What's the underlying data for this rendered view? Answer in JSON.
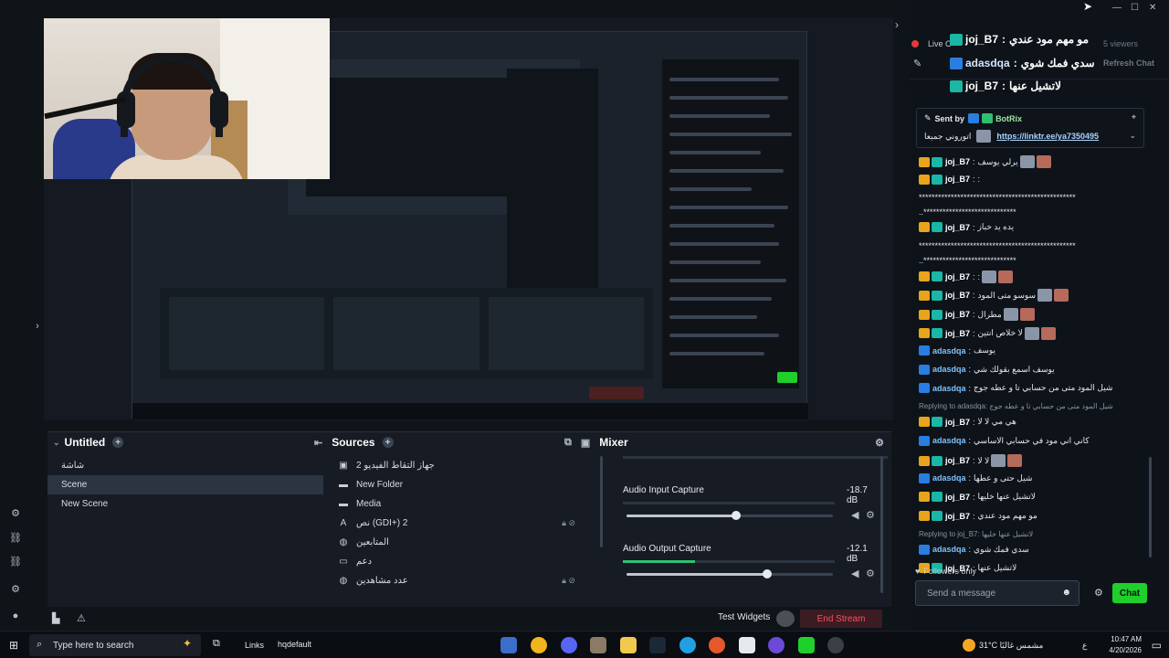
{
  "preview": {
    "nested_label": "Live Chat"
  },
  "docks": {
    "scenes": {
      "title": "Untitled",
      "items": [
        "شاشة",
        "Scene",
        "New Scene"
      ]
    },
    "sources": {
      "title": "Sources",
      "items": [
        {
          "icon": "camera-icon",
          "label": "جهاز التقاط الفيديو 2"
        },
        {
          "icon": "folder-icon",
          "label": "New Folder"
        },
        {
          "icon": "folder-icon",
          "label": "Media"
        },
        {
          "icon": "text-icon",
          "label": "نص (GDI+) 2"
        },
        {
          "icon": "globe-icon",
          "label": "المتابعين"
        },
        {
          "icon": "monitor-icon",
          "label": "دعم"
        },
        {
          "icon": "globe-icon",
          "label": "عدد مشاهدين"
        }
      ]
    },
    "mixer": {
      "title": "Mixer",
      "channels": [
        {
          "name": "Audio Input Capture",
          "db": "-18.7 dB",
          "level": 0.53,
          "meter": 0.0
        },
        {
          "name": "Audio Output Capture",
          "db": "-12.1 dB",
          "level": 0.68,
          "meter": 0.34
        }
      ]
    }
  },
  "bottom": {
    "test_widgets": "Test Widgets",
    "end_stream": "End Stream"
  },
  "chat": {
    "live_label": "Live C",
    "viewers": "5 viewers",
    "refresh": "Refresh Chat",
    "top_lines": [
      {
        "user": "joj_B7",
        "msg": "مو مهم مود عندي"
      },
      {
        "user": "adasdqa",
        "msg": "سدي فمك شوي"
      },
      {
        "user": "joj_B7",
        "msg": "لاتشيل عنها"
      }
    ],
    "pin": {
      "sent_by": "Sent by",
      "bot": "BotRix",
      "link": "https://linktr.ee/ya7350495",
      "text": "اتوروني جميعا"
    },
    "messages": [
      {
        "user": "joj_B7",
        "msg": "يرلي يوسف",
        "type": "mod",
        "emote": true
      },
      {
        "user": "joj_B7",
        "msg": ":",
        "type": "mod"
      },
      {
        "user": "",
        "msg": "*************************************************",
        "type": "cont"
      },
      {
        "user": "",
        "msg": "..*****************************",
        "type": "cont"
      },
      {
        "user": "joj_B7",
        "msg": "يده يد خباز",
        "type": "mod"
      },
      {
        "user": "",
        "msg": "*************************************************",
        "type": "cont"
      },
      {
        "user": "",
        "msg": "..*****************************",
        "type": "cont"
      },
      {
        "user": "joj_B7",
        "msg": ":",
        "type": "mod",
        "emote": true
      },
      {
        "user": "joj_B7",
        "msg": "سوسو متى المود",
        "type": "mod",
        "emote": true
      },
      {
        "user": "joj_B7",
        "msg": "مطرال",
        "type": "mod",
        "emote": true
      },
      {
        "user": "joj_B7",
        "msg": "لا خلاص انتين",
        "type": "mod",
        "emote": true
      },
      {
        "user": "adasdqa",
        "msg": "يوسف",
        "type": "user"
      },
      {
        "user": "adasdqa",
        "msg": "يوسف اسمع بقولك شي",
        "type": "user"
      },
      {
        "user": "adasdqa",
        "msg": "شيل المود متى من حسابي تا و عطه جوج",
        "type": "user"
      },
      {
        "user": "",
        "msg": "Replying to adasdqa: شيل المود متى من حسابي تا و عطه جوج",
        "type": "reply"
      },
      {
        "user": "joj_B7",
        "msg": "هي مي لا لا",
        "type": "mod"
      },
      {
        "user": "adasdqa",
        "msg": "كاني اني مود في حسابي الاساسي",
        "type": "user"
      },
      {
        "user": "joj_B7",
        "msg": "لا لا",
        "type": "mod",
        "emote": true
      },
      {
        "user": "adasdqa",
        "msg": "شيل حتى و عطها",
        "type": "user"
      },
      {
        "user": "joj_B7",
        "msg": "لاتشيل عنها خليها",
        "type": "mod"
      },
      {
        "user": "joj_B7",
        "msg": "مو مهم مود عندي",
        "type": "mod"
      },
      {
        "user": "",
        "msg": "Replying to joj_B7: لاتشيل عنها خليها",
        "type": "reply"
      },
      {
        "user": "adasdqa",
        "msg": "سدي فمك شوي",
        "type": "user"
      },
      {
        "user": "joj_B7",
        "msg": "لاتشيل عنها",
        "type": "mod"
      }
    ],
    "followers_only": "Followers only",
    "send_placeholder": "Send a message",
    "chat_button": "Chat"
  },
  "taskbar": {
    "search": "Type here to search",
    "links": "Links",
    "profile": "hqdefault",
    "weather": "31°C مشمس غالبًا",
    "lang": "ع",
    "time": "10:47 AM",
    "date": "4/20/2026"
  },
  "colors": {
    "accent_green": "#1fd02b",
    "end_stream": "#ff4d5e",
    "mod_badge": "#19b7a4",
    "crown_badge": "#e6a51b"
  }
}
